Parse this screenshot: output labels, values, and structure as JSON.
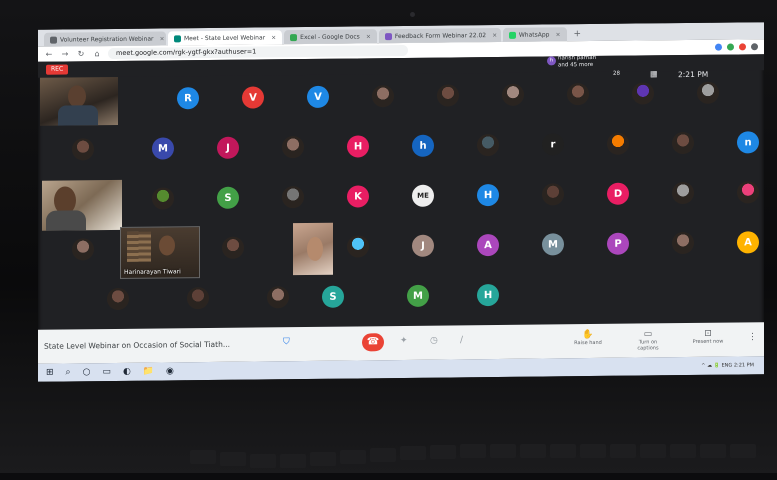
{
  "browser": {
    "tabs": [
      {
        "label": "Volunteer Registration Webinar"
      },
      {
        "label": "Meet - State Level Webinar"
      },
      {
        "label": "Excel - Google Docs"
      },
      {
        "label": "Feedback Form Webinar 22.02"
      },
      {
        "label": "WhatsApp"
      }
    ],
    "new_tab": "+",
    "url": "meet.google.com/rgk-ygtf-gkx?authuser=1",
    "nav": {
      "back": "←",
      "forward": "→",
      "reload": "↻",
      "home": "⌂"
    }
  },
  "meet": {
    "rec_label": "REC",
    "pinned": {
      "initial": "h",
      "line1": "harish parhan",
      "line2": "and 45 more"
    },
    "clock": "2:21 PM",
    "layout_label": "28",
    "view_icon": "▦",
    "meeting_name": "State Level Webinar on Occasion of Social Tiath...",
    "presenter_name": "Harinarayan Tiwari",
    "bottom_buttons": [
      {
        "icon": "✋",
        "label": "Raise hand"
      },
      {
        "icon": "▭",
        "label": "Turn on captions"
      },
      {
        "icon": "⊡",
        "label": "Present now"
      }
    ],
    "more_icon": "⋮",
    "end_icon": "☎",
    "mic_icon": "✦",
    "cam_icon": "◷",
    "pen_icon": "/"
  },
  "participants": [
    {
      "label": "R",
      "color": "#1e88e5"
    },
    {
      "label": "V",
      "color": "#e53935"
    },
    {
      "label": "V",
      "color": "#1e88e5"
    },
    {
      "label": "",
      "color": "#8d6e63"
    },
    {
      "label": "",
      "color": "#6d4c41"
    },
    {
      "label": "",
      "color": "#a1887f"
    },
    {
      "label": "",
      "color": "#795548"
    },
    {
      "label": "",
      "color": "#5e35b1"
    },
    {
      "label": "",
      "color": "#9e9e9e"
    },
    {
      "label": "",
      "color": "#6d4c41"
    },
    {
      "label": "M",
      "color": "#3949ab"
    },
    {
      "label": "J",
      "color": "#c2185b"
    },
    {
      "label": "",
      "color": "#8d6e63"
    },
    {
      "label": "H",
      "color": "#e91e63"
    },
    {
      "label": "h",
      "color": "#1565c0"
    },
    {
      "label": "",
      "color": "#455a64"
    },
    {
      "label": "r",
      "color": "#212121"
    },
    {
      "label": "",
      "color": "#f57c00"
    },
    {
      "label": "",
      "color": "#6d4c41"
    },
    {
      "label": "n",
      "color": "#1e88e5"
    },
    {
      "label": "",
      "color": "#558b2f"
    },
    {
      "label": "S",
      "color": "#43a047"
    },
    {
      "label": "",
      "color": "#757575"
    },
    {
      "label": "K",
      "color": "#e91e63"
    },
    {
      "label": "ME",
      "color": "#eeeeee"
    },
    {
      "label": "H",
      "color": "#1e88e5"
    },
    {
      "label": "",
      "color": "#5d4037"
    },
    {
      "label": "D",
      "color": "#e91e63"
    },
    {
      "label": "",
      "color": "#9e9e9e"
    },
    {
      "label": "",
      "color": "#ec407a"
    },
    {
      "label": "",
      "color": "#8d6e63"
    },
    {
      "label": "",
      "color": "#6d4c41"
    },
    {
      "label": "",
      "color": "#4fc3f7"
    },
    {
      "label": "J",
      "color": "#a1887f"
    },
    {
      "label": "A",
      "color": "#ab47bc"
    },
    {
      "label": "M",
      "color": "#78909c"
    },
    {
      "label": "P",
      "color": "#ab47bc"
    },
    {
      "label": "",
      "color": "#8d6e63"
    },
    {
      "label": "A",
      "color": "#ffb300"
    },
    {
      "label": "",
      "color": "#6d4c41"
    },
    {
      "label": "",
      "color": "#5d4037"
    },
    {
      "label": "",
      "color": "#8d6e63"
    },
    {
      "label": "S",
      "color": "#26a69a"
    },
    {
      "label": "M",
      "color": "#43a047"
    },
    {
      "label": "H",
      "color": "#26a69a"
    }
  ],
  "taskbar": {
    "icons": [
      "⊞",
      "⌕",
      "○",
      "▭",
      "◐",
      "📁",
      "◉"
    ],
    "tray": "^ ☁ 🔋 ENG 2:21 PM"
  }
}
